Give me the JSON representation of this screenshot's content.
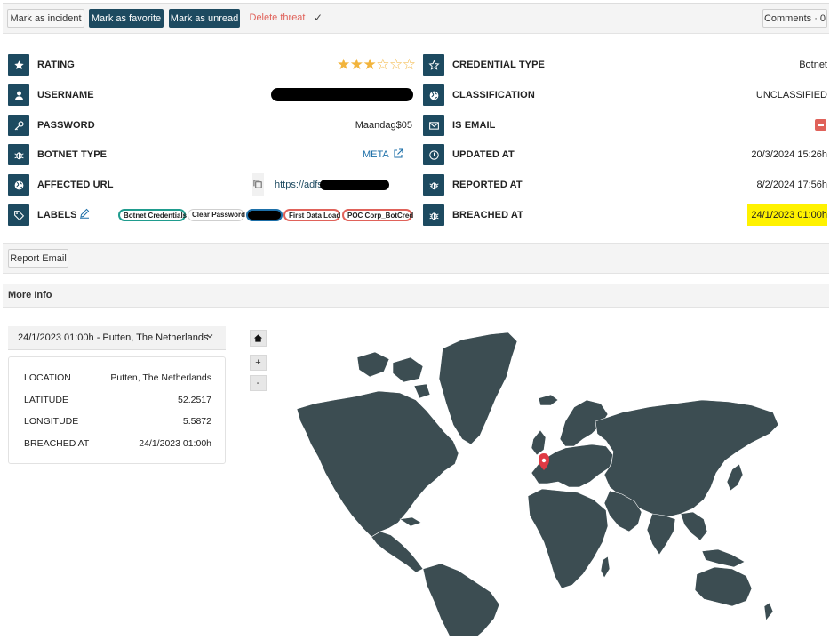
{
  "toolbar": {
    "mark_incident": "Mark as incident",
    "mark_favorite": "Mark as favorite",
    "mark_unread": "Mark as unread",
    "delete_threat": "Delete threat",
    "comments": "Comments · 0"
  },
  "fields": {
    "rating": {
      "label": "RATING",
      "stars_filled": 3,
      "stars_total": 6
    },
    "username": {
      "label": "USERNAME"
    },
    "password": {
      "label": "PASSWORD",
      "value": "Maandag$05"
    },
    "botnet_type": {
      "label": "BOTNET TYPE",
      "value": "META"
    },
    "affected_url": {
      "label": "AFFECTED URL",
      "value": "https://adfs."
    },
    "labels": {
      "label": "LABELS"
    },
    "credential_type": {
      "label": "CREDENTIAL TYPE",
      "value": "Botnet"
    },
    "classification": {
      "label": "CLASSIFICATION",
      "value": "UNCLASSIFIED"
    },
    "is_email": {
      "label": "IS EMAIL"
    },
    "updated_at": {
      "label": "UPDATED AT",
      "value": "20/3/2024 15:26h"
    },
    "reported_at": {
      "label": "REPORTED AT",
      "value": "8/2/2024 17:56h"
    },
    "breached_at": {
      "label": "BREACHED AT",
      "value": "24/1/2023 01:00h"
    }
  },
  "labels": [
    "Botnet Credentials",
    "Clear Password",
    "First Data Load",
    "POC Corp_BotCred"
  ],
  "colors": {
    "accent": "#1d4a60",
    "danger": "#e0625a",
    "highlight": "#fff200",
    "map_land": "#3c4d52",
    "pin": "#e03a44",
    "teal_label": "#1f9c8e"
  },
  "report_email": "Report Email",
  "more_info": {
    "title": "More Info",
    "selector": "24/1/2023 01:00h - Putten, The Netherlands",
    "rows": [
      {
        "key": "LOCATION",
        "value": "Putten, The Netherlands"
      },
      {
        "key": "LATITUDE",
        "value": "52.2517"
      },
      {
        "key": "LONGITUDE",
        "value": "5.5872"
      },
      {
        "key": "BREACHED AT",
        "value": "24/1/2023 01:00h"
      }
    ],
    "zoom_in": "+",
    "zoom_out": "-"
  }
}
